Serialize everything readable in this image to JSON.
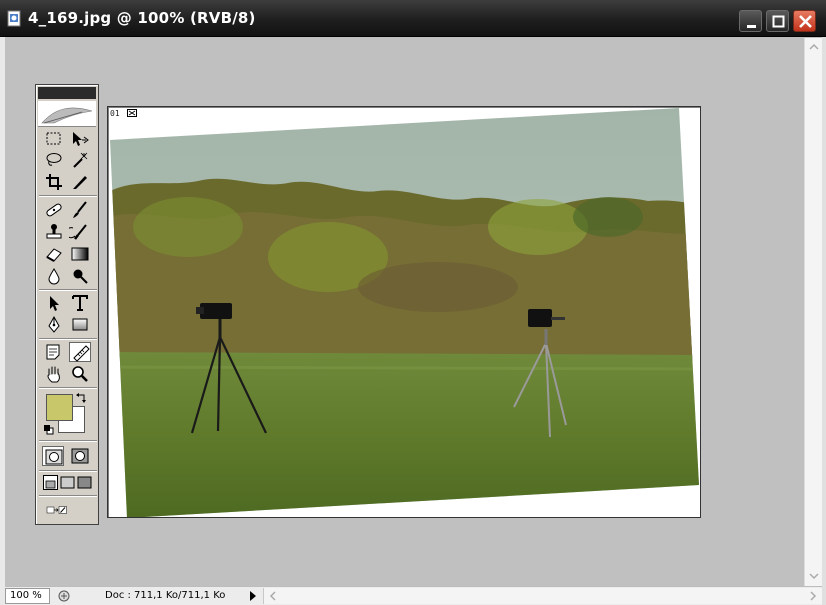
{
  "window": {
    "title": "4_169.jpg @ 100% (RVB/8)",
    "controls": [
      "minimize-icon",
      "maximize-icon",
      "close-icon"
    ]
  },
  "toolbox": {
    "tools": [
      "rect-marquee-icon",
      "move-icon",
      "lasso-icon",
      "magic-wand-icon",
      "crop-icon",
      "slice-icon",
      "healing-brush-icon",
      "brush-icon",
      "clone-stamp-icon",
      "history-brush-icon",
      "eraser-icon",
      "gradient-icon",
      "blur-icon",
      "dodge-icon",
      "path-selection-icon",
      "type-icon",
      "pen-icon",
      "rectangle-shape-icon",
      "notes-icon",
      "measure-icon",
      "hand-icon",
      "zoom-icon"
    ],
    "foreground_color": "#c8c86a",
    "background_color": "#ffffff"
  },
  "document": {
    "corner_label": "01"
  },
  "status": {
    "zoom": "100 %",
    "doc_info": "Doc : 711,1 Ko/711,1 Ko"
  }
}
